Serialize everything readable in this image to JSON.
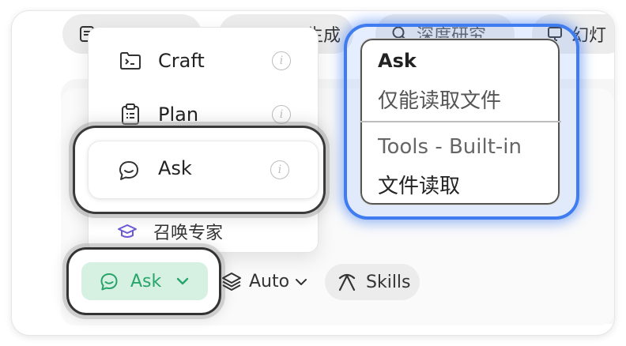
{
  "tabs": [
    {
      "label": "",
      "icon": "document-icon"
    },
    {
      "label": "生成",
      "icon": ""
    },
    {
      "label": "深度研究",
      "icon": "search-icon"
    },
    {
      "label": "幻灯",
      "icon": "slides-icon"
    }
  ],
  "mode_menu": {
    "items": [
      {
        "label": "Craft",
        "icon": "terminal-folder-icon"
      },
      {
        "label": "Plan",
        "icon": "clipboard-list-icon"
      },
      {
        "label": "Ask",
        "icon": "chat-bubble-icon",
        "selected": true
      }
    ],
    "expert": {
      "label": "召唤专家",
      "icon": "graduation-cap-icon"
    }
  },
  "tooltip": {
    "title": "Ask",
    "description": "仅能读取文件",
    "tools_heading": "Tools - Built-in",
    "tool_item": "文件读取"
  },
  "toolbar": {
    "ask_label": "Ask",
    "auto_label": "Auto",
    "skills_label": "Skills"
  },
  "colors": {
    "accent_green": "#27a56a",
    "ask_bg": "#d6f0e2",
    "highlight_blue": "#3f7cf0"
  }
}
